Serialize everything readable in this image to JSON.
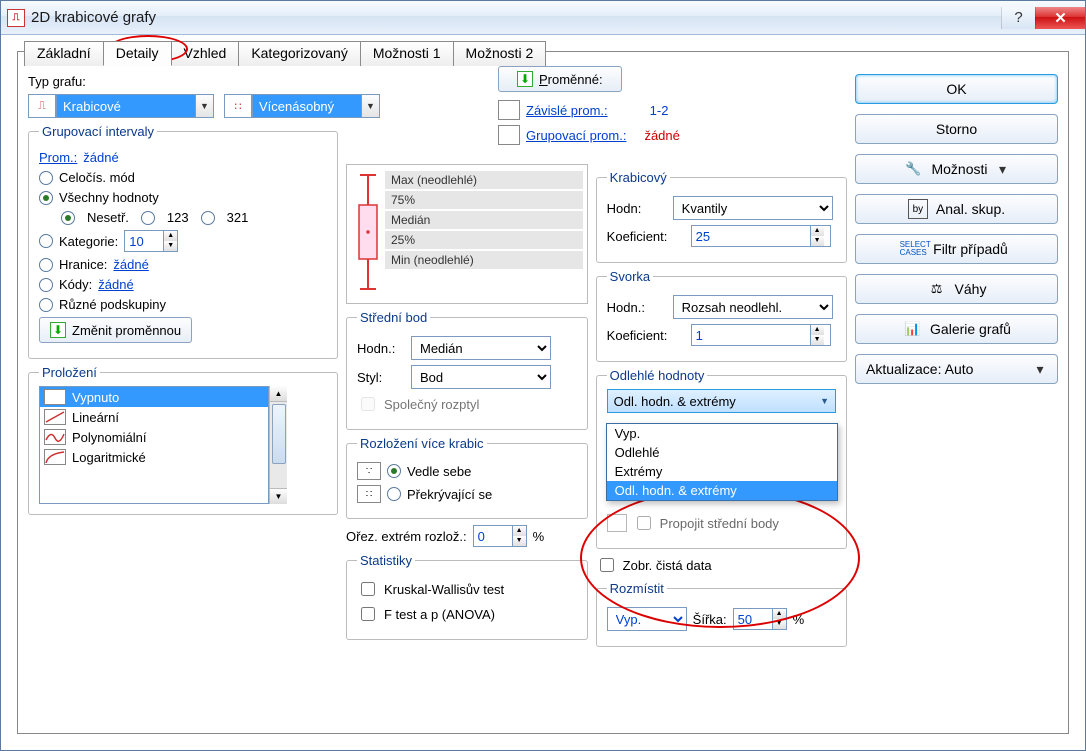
{
  "title": "2D krabicové grafy",
  "tabs": [
    "Základní",
    "Detaily",
    "Vzhled",
    "Kategorizovaný",
    "Možnosti 1",
    "Možnosti 2"
  ],
  "activeTab": 1,
  "typGrafu": {
    "label": "Typ grafu:",
    "primary": "Krabicové",
    "secondary": "Vícenásobný"
  },
  "promenneBtn": "Proměnné:",
  "zavisle": {
    "label": "Závislé prom.:",
    "value": "1-2"
  },
  "grupovaci": {
    "label": "Grupovací prom.:",
    "value": "žádné"
  },
  "grupInterval": {
    "legend": "Grupovací intervaly",
    "promLabel": "Prom.:",
    "promValue": "žádné",
    "celocis": "Celočís. mód",
    "vsechny": "Všechny hodnoty",
    "nesetr": "Nesetř.",
    "r123": "123",
    "r321": "321",
    "kategorie": "Kategorie:",
    "kategorieVal": "10",
    "hranice": "Hranice:",
    "hraniceVal": "žádné",
    "kody": "Kódy:",
    "kodyVal": "žádné",
    "ruzne": "Různé podskupiny",
    "zmenitBtn": "Změnit proměnnou"
  },
  "prolozeni": {
    "legend": "Proložení",
    "items": [
      "Vypnuto",
      "Lineární",
      "Polynomiální",
      "Logaritmické"
    ]
  },
  "boxLegend": {
    "max": "Max (neodlehlé)",
    "p75": "75%",
    "median": "Medián",
    "p25": "25%",
    "min": "Min (neodlehlé)"
  },
  "stredniBod": {
    "legend": "Střední bod",
    "hodnLabel": "Hodn.:",
    "hodnVal": "Medián",
    "stylLabel": "Styl:",
    "stylVal": "Bod",
    "spolecny": "Společný rozptyl"
  },
  "rozlozeni": {
    "legend": "Rozložení více krabic",
    "vedle": "Vedle sebe",
    "prekr": "Překrývající se"
  },
  "orez": {
    "label": "Ořez. extrém rozlož.:",
    "val": "0",
    "suffix": "%"
  },
  "statistiky": {
    "legend": "Statistiky",
    "kw": "Kruskal-Wallisův test",
    "f": "F test a p (ANOVA)"
  },
  "krabicovyGrp": {
    "legend": "Krabicový",
    "hodnLabel": "Hodn:",
    "hodnVal": "Kvantily",
    "koefLabel": "Koeficient:",
    "koefVal": "25"
  },
  "svorka": {
    "legend": "Svorka",
    "hodnLabel": "Hodn.:",
    "hodnVal": "Rozsah neodlehl.",
    "koefLabel": "Koeficient:",
    "koefVal": "1"
  },
  "odlehle": {
    "legend": "Odlehlé hodnoty",
    "selected": "Odl. hodn. & extrémy",
    "options": [
      "Vyp.",
      "Odlehlé",
      "Extrémy",
      "Odl. hodn. & extrémy"
    ],
    "propojit": "Propojit střední body"
  },
  "zobrCista": "Zobr. čistá data",
  "rozmistit": {
    "legend": "Rozmístit",
    "val": "Vyp.",
    "sirkaLabel": "Šířka:",
    "sirkaVal": "50",
    "suffix": "%"
  },
  "buttons": {
    "ok": "OK",
    "storno": "Storno",
    "moznosti": "Možnosti",
    "anal": "Anal. skup.",
    "filtr": "Filtr případů",
    "vahy": "Váhy",
    "galerie": "Galerie grafů",
    "aktualizace": "Aktualizace: Auto"
  }
}
